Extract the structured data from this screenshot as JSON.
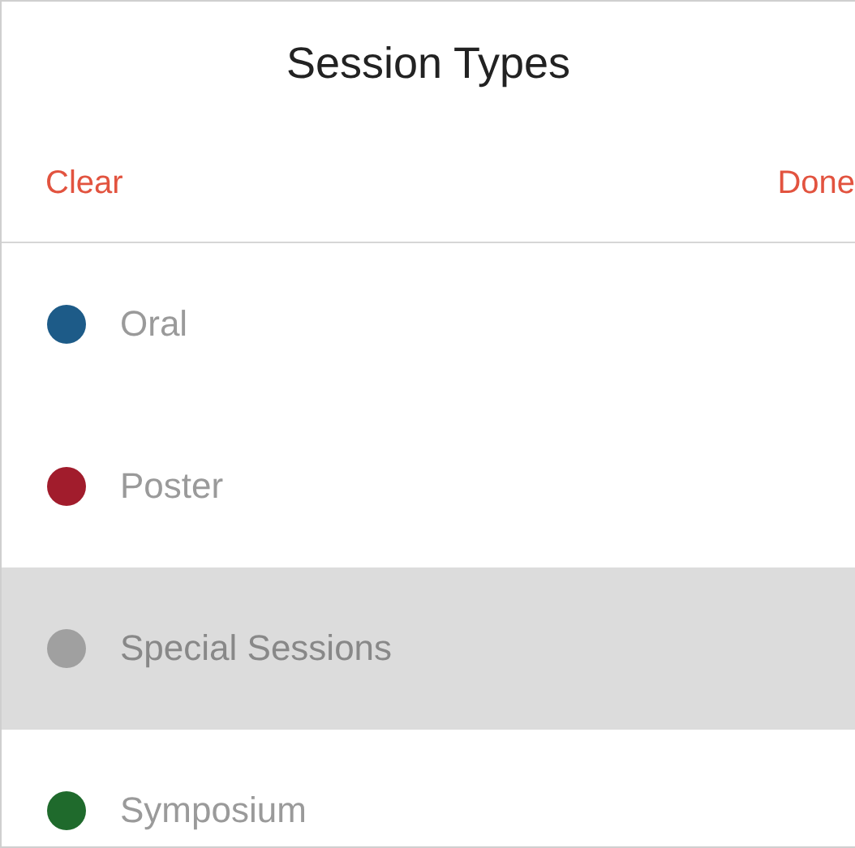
{
  "title": "Session Types",
  "actions": {
    "clear": "Clear",
    "done": "Done"
  },
  "session_types": [
    {
      "label": "Oral",
      "color": "#1d5b88",
      "selected": false
    },
    {
      "label": "Poster",
      "color": "#a11c2c",
      "selected": false
    },
    {
      "label": "Special Sessions",
      "color": "#a0a0a0",
      "selected": true
    },
    {
      "label": "Symposium",
      "color": "#1f6a2c",
      "selected": false
    }
  ]
}
